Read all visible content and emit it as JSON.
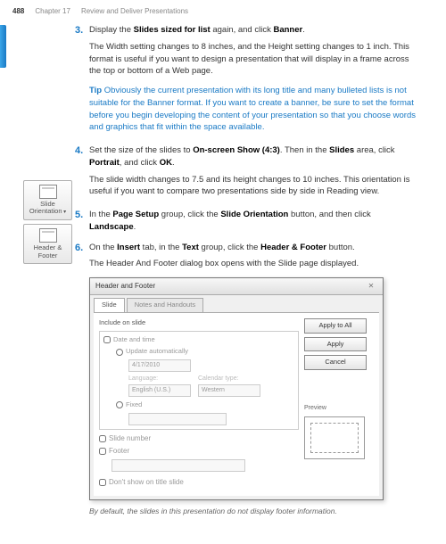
{
  "header": {
    "page": "488",
    "chapter": "Chapter 17",
    "section": "Review and Deliver Presentations"
  },
  "steps": {
    "s3": {
      "num": "3.",
      "text_a": "Display the ",
      "bold_a": "Slides sized for list",
      "text_b": " again, and click ",
      "bold_b": "Banner",
      "text_c": ".",
      "follow": "The Width setting changes to 8 inches, and the Height setting changes to 1 inch. This format is useful if you want to design a presentation that will display in a frame across the top or bottom of a Web page."
    },
    "tip": {
      "label": "Tip",
      "text": " Obviously the current presentation with its long title and many bulleted lists is not suitable for the Banner format. If you want to create a banner, be sure to set the format before you begin developing the content of your presentation so that you choose words and graphics that fit within the space available."
    },
    "s4": {
      "num": "4.",
      "text_a": "Set the size of the slides to ",
      "bold_a": "On-screen Show (4:3)",
      "text_b": ". Then in the ",
      "bold_b": "Slides",
      "text_c": " area, click ",
      "bold_c": "Portrait",
      "text_d": ", and click ",
      "bold_d": "OK",
      "text_e": ".",
      "follow": "The slide width changes to 7.5 and its height changes to 10 inches. This orientation is useful if you want to compare two presentations side by side in Reading view."
    },
    "s5": {
      "num": "5.",
      "text_a": "In the ",
      "bold_a": "Page Setup",
      "text_b": " group, click the ",
      "bold_b": "Slide Orientation",
      "text_c": " button, and then click ",
      "bold_c": "Landscape",
      "text_d": "."
    },
    "s6": {
      "num": "6.",
      "text_a": "On the ",
      "bold_a": "Insert",
      "text_b": " tab, in the ",
      "bold_b": "Text",
      "text_c": " group, click the ",
      "bold_c": "Header & Footer",
      "text_d": " button.",
      "follow": "The Header And Footer dialog box opens with the Slide page displayed."
    }
  },
  "sidebar": {
    "slide_orientation": "Slide Orientation",
    "header_footer": "Header & Footer"
  },
  "dialog": {
    "title": "Header and Footer",
    "tab1": "Slide",
    "tab2": "Notes and Handouts",
    "include_label": "Include on slide",
    "date_time": "Date and time",
    "update_auto": "Update automatically",
    "date_value": "4/17/2010",
    "language_label": "Language:",
    "language_value": "English (U.S.)",
    "calendar_label": "Calendar type:",
    "calendar_value": "Western",
    "fixed": "Fixed",
    "slide_number": "Slide number",
    "footer": "Footer",
    "dont_show": "Don't show on title slide",
    "apply_all": "Apply to All",
    "apply": "Apply",
    "cancel": "Cancel",
    "preview": "Preview"
  },
  "caption": "By default, the slides in this presentation do not display footer information."
}
